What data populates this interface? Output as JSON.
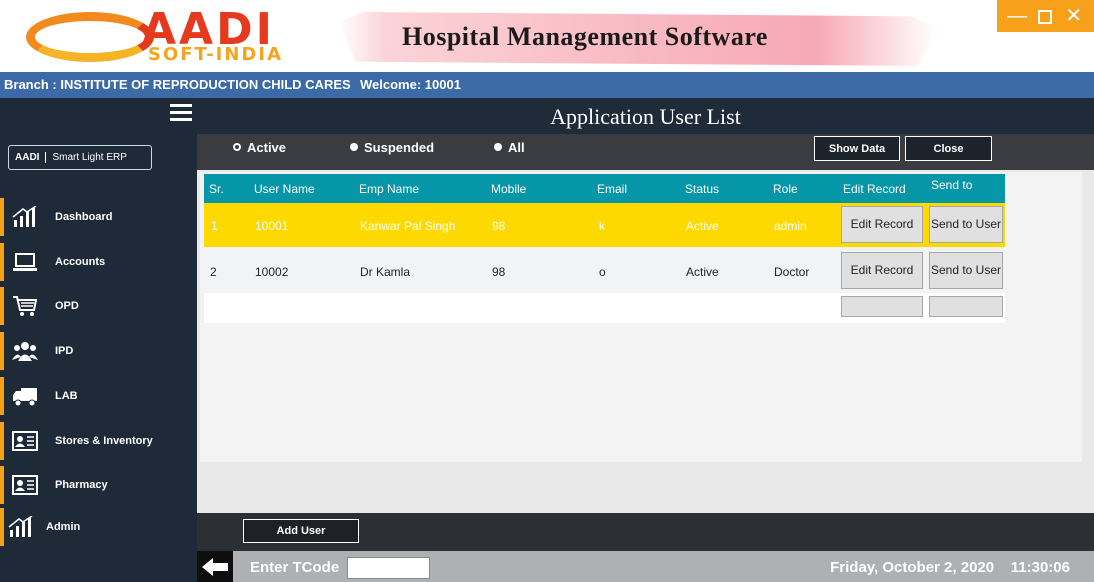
{
  "header": {
    "logo_name": "AADI",
    "logo_sub": "SOFT-INDIA",
    "app_title": "Hospital Management Software",
    "window_controls": {
      "minimize": "—",
      "maximize": "☐",
      "close": "✕"
    }
  },
  "branch_bar": {
    "branch": "Branch : INSTITUTE OF REPRODUCTION  CHILD CARES",
    "welcome": "Welcome: 10001"
  },
  "sidebar": {
    "badge_logo": "AADI",
    "badge_text": "Smart Light ERP",
    "items": [
      {
        "label": "Dashboard",
        "icon": "bar-chart-icon"
      },
      {
        "label": "Accounts",
        "icon": "laptop-icon"
      },
      {
        "label": "OPD",
        "icon": "cart-icon"
      },
      {
        "label": "IPD",
        "icon": "people-icon"
      },
      {
        "label": "LAB",
        "icon": "truck-icon"
      },
      {
        "label": "Stores & Inventory",
        "icon": "id-card-icon"
      },
      {
        "label": "Pharmacy",
        "icon": "id-card-icon"
      },
      {
        "label": "Admin",
        "icon": "bar-chart-icon"
      }
    ]
  },
  "page": {
    "title": "Application User List",
    "filters": {
      "active": "Active",
      "suspended": "Suspended",
      "all": "All"
    },
    "show_data": "Show Data",
    "close": "Close"
  },
  "table": {
    "columns": [
      "Sr.",
      "User Name",
      "Emp Name",
      "Mobile",
      "Email",
      "Status",
      "Role",
      "Edit Record",
      "Send to"
    ],
    "rows": [
      {
        "sr": "1",
        "user": "10001",
        "emp": "Kanwar Pal Singh",
        "mobile": "98",
        "email": "k",
        "status": "Active",
        "role": "admin",
        "edit": "Edit Record",
        "send": "Send to User"
      },
      {
        "sr": "2",
        "user": "10002",
        "emp": "Dr Kamla",
        "mobile": "98",
        "email": "o",
        "status": "Active",
        "role": "Doctor",
        "edit": "Edit Record",
        "send": "Send to User"
      }
    ]
  },
  "bottom": {
    "add_user": "Add User"
  },
  "status": {
    "tcode_label": "Enter TCode",
    "tcode_value": "",
    "datetime": "Friday, October 2, 2020    11:30:06"
  },
  "colors": {
    "accent": "#f3a01b",
    "sidebar": "#1e2a38",
    "branch_bar": "#3c6aa6",
    "table_header": "#0597a8",
    "selected_row": "#fed900"
  }
}
